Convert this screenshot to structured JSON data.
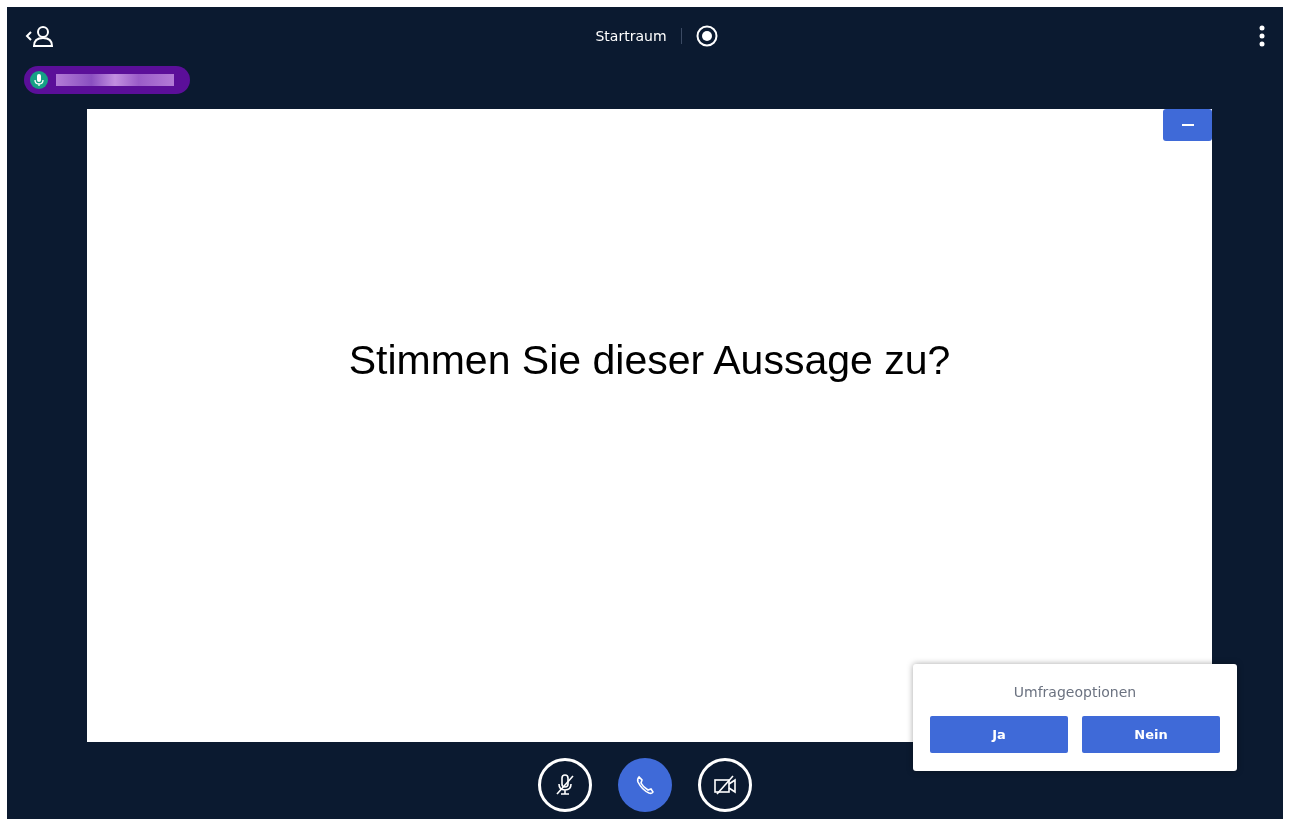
{
  "header": {
    "room_name": "Startraum",
    "recording": false
  },
  "slide": {
    "text": "Stimmen Sie dieser Aussage zu?"
  },
  "poll": {
    "title": "Umfrageoptionen",
    "options": [
      {
        "label": "Ja"
      },
      {
        "label": "Nein"
      }
    ]
  },
  "controls": {
    "mic_muted": true,
    "camera_on": false
  }
}
